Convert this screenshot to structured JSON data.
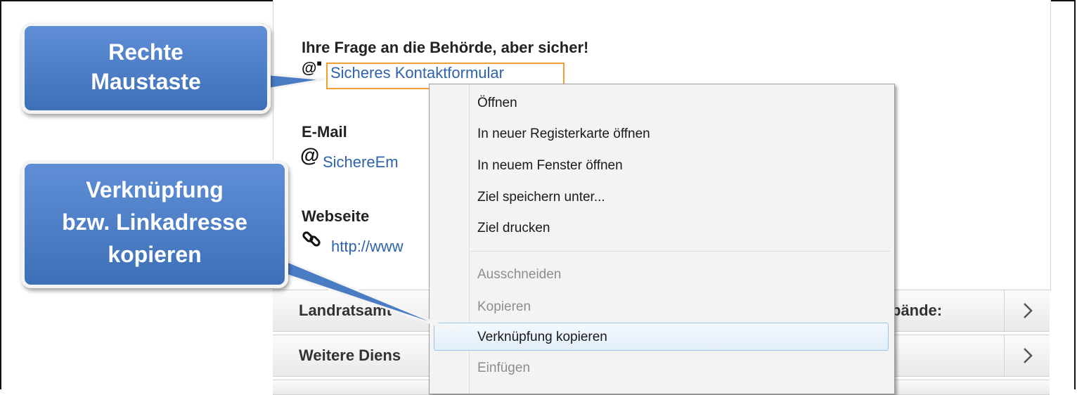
{
  "page": {
    "heading1": "Ihre Frage an die Behörde, aber sicher!",
    "link1": "Sicheres Kontaktformular",
    "heading2": "E-Mail",
    "link2": "SichereEm",
    "heading3": "Webseite",
    "link3": "http://www",
    "bars": [
      {
        "label_left": "Landratsamt",
        "label_right": "bände:"
      },
      {
        "label_left": "Weitere Diens"
      }
    ],
    "icons": [
      "secure-at-icon",
      "at-icon",
      "chain-link-icon",
      "chevron-right-icon"
    ]
  },
  "context_menu": {
    "items": [
      {
        "label": "Öffnen",
        "enabled": true
      },
      {
        "label": "In neuer Registerkarte öffnen",
        "enabled": true
      },
      {
        "label": "In neuem Fenster öffnen",
        "enabled": true
      },
      {
        "label": "Ziel speichern unter...",
        "enabled": true
      },
      {
        "label": "Ziel drucken",
        "enabled": true
      },
      {
        "label": "Ausschneiden",
        "enabled": false
      },
      {
        "label": "Kopieren",
        "enabled": false
      },
      {
        "label": "Verknüpfung kopieren",
        "enabled": true,
        "highlighted": true
      },
      {
        "label": "Einfügen",
        "enabled": false
      }
    ]
  },
  "callouts": {
    "right_click": [
      "Rechte",
      "Maustaste"
    ],
    "copy_link": [
      "Verknüpfung",
      "bzw. Linkadresse",
      "kopieren"
    ]
  },
  "colors": {
    "link": "#2f63ad",
    "callout": "#4a7cc4",
    "focus_outline": "#f0a030",
    "menu_highlight": "#e3eefa"
  }
}
